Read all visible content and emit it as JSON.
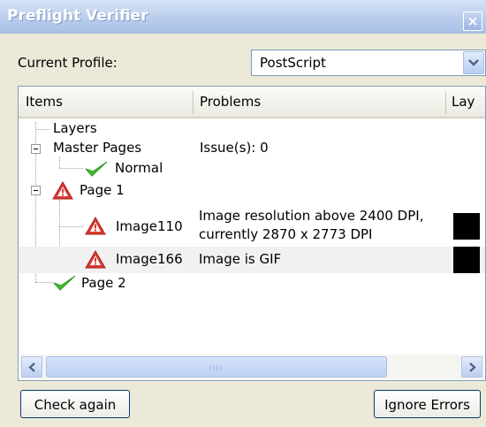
{
  "window": {
    "title": "Preflight Verifier",
    "close_symbol": "×"
  },
  "profile": {
    "label": "Current Profile:",
    "value": "PostScript"
  },
  "columns": {
    "items": "Items",
    "problems": "Problems",
    "layers": "Lay"
  },
  "tree": [
    {
      "label": "Layers",
      "problem": ""
    },
    {
      "label": "Master Pages",
      "problem": "Issue(s): 0"
    },
    {
      "label": "Normal",
      "problem": "",
      "status": "ok"
    },
    {
      "label": "Page 1",
      "problem": "",
      "status": "warning"
    },
    {
      "label": "Image110",
      "problem_line1": "Image resolution above 2400 DPI,",
      "problem_line2": "currently 2870 x 2773 DPI",
      "status": "warning",
      "swatch_color": "#000000"
    },
    {
      "label": "Image166",
      "problem": "Image is GIF",
      "status": "warning",
      "swatch_color": "#000000"
    },
    {
      "label": "Page 2",
      "problem": "",
      "status": "ok"
    }
  ],
  "buttons": {
    "check_again": "Check again",
    "ignore_errors": "Ignore Errors"
  },
  "colors": {
    "ok_green": "#3fbf2a",
    "warning_red": "#d83a33"
  }
}
